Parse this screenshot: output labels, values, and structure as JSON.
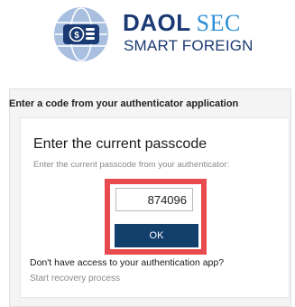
{
  "logo": {
    "brand_primary": "DAOL",
    "brand_secondary": "SEC",
    "tagline": "SMART FOREIGN",
    "icon": "globe-coins-icon",
    "colors": {
      "navy": "#1b3a73",
      "blue": "#2b8fd6",
      "mark": "#a9bfe0"
    }
  },
  "panel": {
    "title": "Enter a code from your authenticator application"
  },
  "card": {
    "heading": "Enter the current passcode",
    "subheading": "Enter the current passcode from your authenticator:"
  },
  "form": {
    "passcode_value": "874096",
    "ok_label": "OK"
  },
  "footer": {
    "no_access_text": "Don't have access to your authentication app?",
    "recovery_label": "Start recovery process"
  },
  "colors": {
    "button": "#123f6c",
    "highlight": "#e84a4d"
  }
}
